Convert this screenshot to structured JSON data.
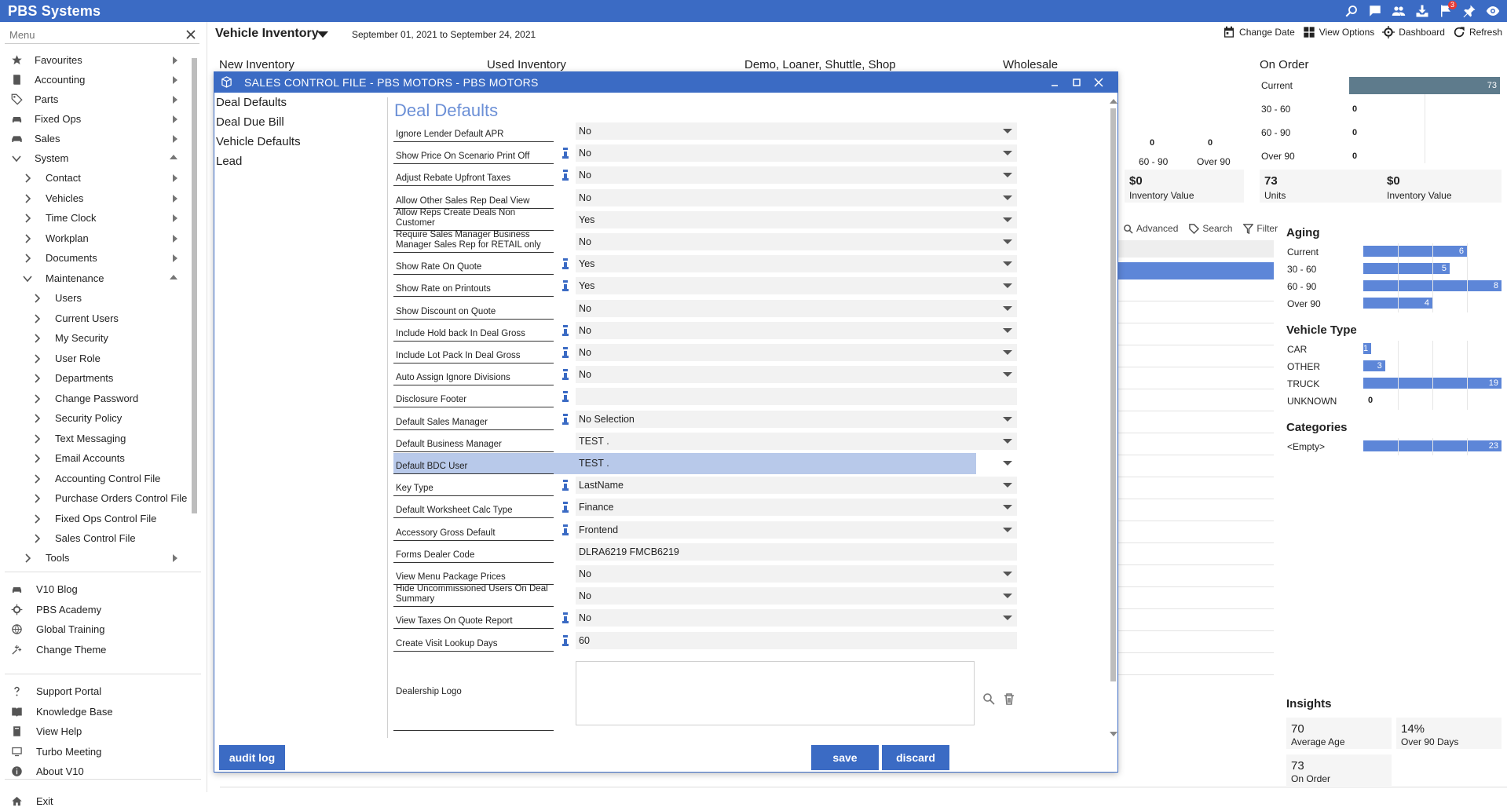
{
  "app": {
    "title": "PBS Systems",
    "notification_count": "3"
  },
  "top_icons": [
    "search-icon",
    "chat-icon",
    "users-icon",
    "inbox-icon",
    "flag-icon",
    "pin-icon",
    "eye-icon"
  ],
  "menu": {
    "placeholder": "Menu",
    "items": [
      {
        "label": "Favourites",
        "icon": "star-icon"
      },
      {
        "label": "Accounting",
        "icon": "book-icon"
      },
      {
        "label": "Parts",
        "icon": "tag-icon"
      },
      {
        "label": "Fixed Ops",
        "icon": "car-icon"
      },
      {
        "label": "Sales",
        "icon": "car-front-icon"
      },
      {
        "label": "System"
      }
    ],
    "system_children": [
      "Contact",
      "Vehicles",
      "Time Clock",
      "Workplan",
      "Documents",
      "Maintenance"
    ],
    "maintenance_children": [
      "Users",
      "Current Users",
      "My Security",
      "User Role",
      "Departments",
      "Change Password",
      "Security Policy",
      "Text Messaging",
      "Email Accounts",
      "Accounting Control File",
      "Purchase Orders Control File",
      "Fixed Ops Control File",
      "Sales Control File"
    ],
    "tools": "Tools",
    "links": [
      {
        "label": "V10 Blog",
        "icon": "car-icon"
      },
      {
        "label": "PBS Academy",
        "icon": "gear-icon"
      },
      {
        "label": "Global Training",
        "icon": "globe-icon"
      },
      {
        "label": "Change Theme",
        "icon": "palette-icon"
      }
    ],
    "support": [
      {
        "label": "Support Portal",
        "icon": "question-icon"
      },
      {
        "label": "Knowledge Base",
        "icon": "book-open-icon"
      },
      {
        "label": "View Help",
        "icon": "help-book-icon"
      },
      {
        "label": "Turbo Meeting",
        "icon": "monitor-icon"
      },
      {
        "label": "About V10",
        "icon": "info-icon"
      }
    ],
    "exit": "Exit"
  },
  "header": {
    "view_title": "Vehicle Inventory",
    "date_range": "September 01, 2021 to September 24, 2021",
    "actions": [
      "Change Date",
      "View Options",
      "Dashboard",
      "Refresh"
    ]
  },
  "inventory_columns": [
    "New Inventory",
    "Used Inventory",
    "Demo, Loaner, Shuttle, Shop",
    "Wholesale"
  ],
  "wholesale_partial": {
    "bar_values": [
      "0",
      "0"
    ],
    "bar_labels": [
      "60 - 90",
      "Over 90"
    ],
    "inventory_value": "$0",
    "inventory_value_label": "Inventory Value"
  },
  "on_order": {
    "title": "On Order",
    "rows": [
      {
        "label": "Current",
        "value": "73",
        "fraction": 1.0
      },
      {
        "label": "30 - 60",
        "value": "0",
        "fraction": 0
      },
      {
        "label": "60 - 90",
        "value": "0",
        "fraction": 0
      },
      {
        "label": "Over 90",
        "value": "0",
        "fraction": 0
      }
    ],
    "units": "73",
    "units_label": "Units",
    "inventory_value": "$0",
    "inventory_value_label": "Inventory Value"
  },
  "table_tools": [
    "Advanced",
    "Search",
    "Filter"
  ],
  "aging": {
    "title": "Aging",
    "rows": [
      {
        "label": "Current",
        "value": "6",
        "fraction": 0.75
      },
      {
        "label": "30 - 60",
        "value": "5",
        "fraction": 0.625
      },
      {
        "label": "60 - 90",
        "value": "8",
        "fraction": 1.0
      },
      {
        "label": "Over 90",
        "value": "4",
        "fraction": 0.5
      }
    ]
  },
  "vehicle_type": {
    "title": "Vehicle Type",
    "rows": [
      {
        "label": "CAR",
        "value": "1",
        "fraction": 0.0526
      },
      {
        "label": "OTHER",
        "value": "3",
        "fraction": 0.158
      },
      {
        "label": "TRUCK",
        "value": "19",
        "fraction": 1.0
      },
      {
        "label": "UNKNOWN",
        "value": "0",
        "fraction": 0
      }
    ]
  },
  "categories": {
    "title": "Categories",
    "rows": [
      {
        "label": "<Empty>",
        "value": "23",
        "fraction": 1.0
      }
    ]
  },
  "insights": {
    "title": "Insights",
    "tiles": [
      {
        "value": "70",
        "label": "Average Age"
      },
      {
        "value": "14%",
        "label": "Over 90 Days"
      },
      {
        "value": "73",
        "label": "On Order"
      }
    ]
  },
  "modal": {
    "title": "SALES CONTROL FILE - PBS MOTORS - PBS MOTORS",
    "nav": [
      "Deal Defaults",
      "Deal Due Bill",
      "Vehicle Defaults",
      "Lead"
    ],
    "section_title": "Deal Defaults",
    "fields": [
      {
        "label": "Ignore Lender Default APR",
        "value": "No",
        "info": false,
        "dropdown": true
      },
      {
        "label": "Show Price On Scenario Print Off",
        "value": "No",
        "info": true,
        "dropdown": true
      },
      {
        "label": "Adjust Rebate Upfront Taxes",
        "value": "No",
        "info": true,
        "dropdown": true
      },
      {
        "label": "Allow Other Sales Rep Deal View",
        "value": "No",
        "info": false,
        "dropdown": true
      },
      {
        "label": "Allow Reps Create Deals Non Customer",
        "value": "Yes",
        "info": false,
        "dropdown": true
      },
      {
        "label": "Require Sales Manager Business Manager Sales Rep for RETAIL only",
        "value": "No",
        "info": false,
        "dropdown": true
      },
      {
        "label": "Show Rate On Quote",
        "value": "Yes",
        "info": true,
        "dropdown": true
      },
      {
        "label": "Show Rate on Printouts",
        "value": "Yes",
        "info": true,
        "dropdown": true
      },
      {
        "label": "Show Discount on Quote",
        "value": "No",
        "info": false,
        "dropdown": true
      },
      {
        "label": "Include Hold back In Deal Gross",
        "value": "No",
        "info": true,
        "dropdown": true
      },
      {
        "label": "Include Lot Pack In Deal Gross",
        "value": "No",
        "info": true,
        "dropdown": true
      },
      {
        "label": "Auto Assign Ignore Divisions",
        "value": "No",
        "info": true,
        "dropdown": true
      },
      {
        "label": "Disclosure Footer",
        "value": "",
        "info": true,
        "dropdown": false
      },
      {
        "label": "Default Sales Manager",
        "value": "No Selection",
        "info": true,
        "dropdown": true
      },
      {
        "label": "Default Business Manager",
        "value": "TEST .",
        "info": false,
        "dropdown": true
      },
      {
        "label": "Default BDC User",
        "value": "TEST .",
        "info": false,
        "dropdown": true,
        "highlight": true
      },
      {
        "label": "Key Type",
        "value": "LastName",
        "info": true,
        "dropdown": true
      },
      {
        "label": "Default Worksheet Calc Type",
        "value": "Finance",
        "info": true,
        "dropdown": true
      },
      {
        "label": "Accessory Gross Default",
        "value": "Frontend",
        "info": true,
        "dropdown": true
      },
      {
        "label": "Forms Dealer Code",
        "value": "DLRA6219 FMCB6219",
        "info": false,
        "dropdown": false
      },
      {
        "label": "View Menu Package Prices",
        "value": "No",
        "info": false,
        "dropdown": true
      },
      {
        "label": "Hide Uncommissioned Users On Deal Summary",
        "value": "No",
        "info": false,
        "dropdown": true
      },
      {
        "label": "View Taxes On Quote Report",
        "value": "No",
        "info": true,
        "dropdown": true
      },
      {
        "label": "Create Visit Lookup Days",
        "value": "60",
        "info": true,
        "dropdown": false
      }
    ],
    "logo_label": "Dealership Logo",
    "buttons": {
      "audit": "audit log",
      "save": "save",
      "discard": "discard"
    }
  }
}
